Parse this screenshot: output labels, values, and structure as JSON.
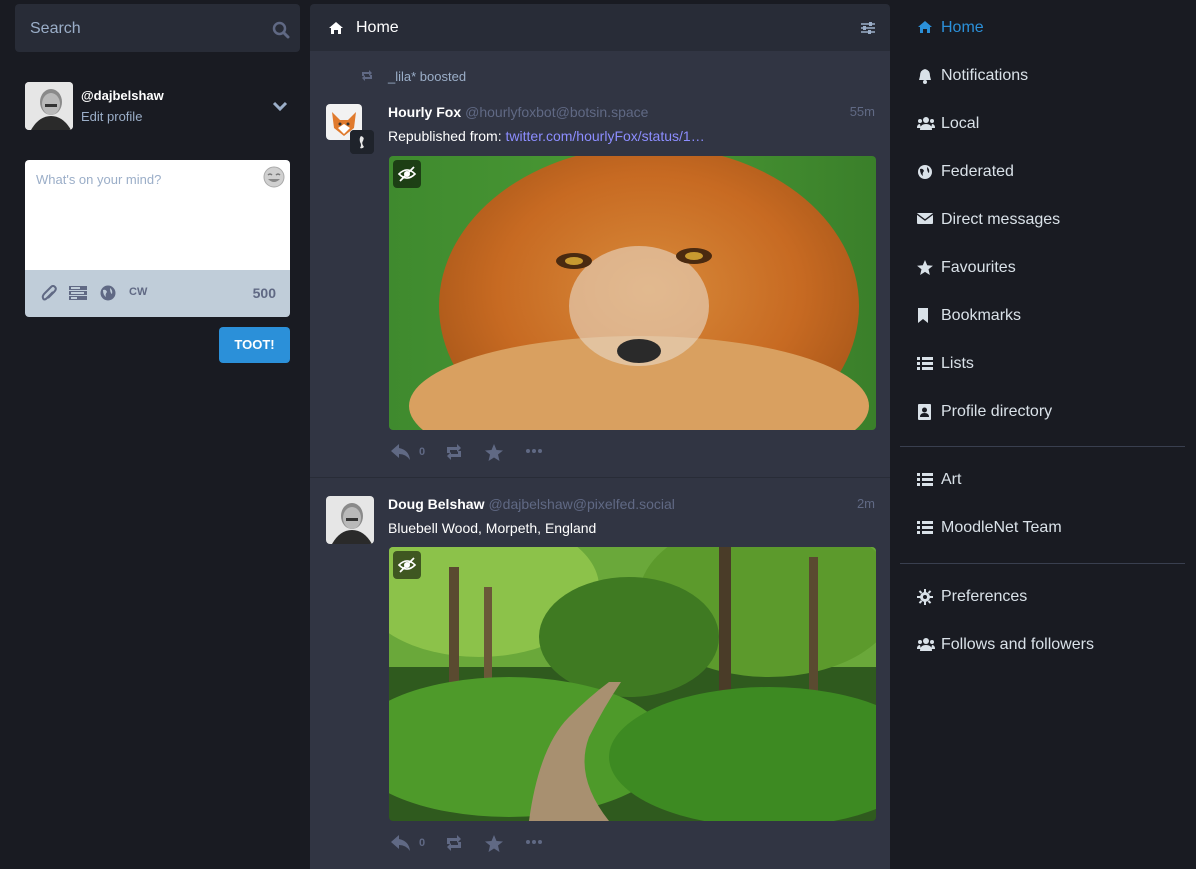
{
  "search": {
    "placeholder": "Search"
  },
  "profile": {
    "acct": "@dajbelshaw",
    "edit_label": "Edit profile"
  },
  "compose": {
    "placeholder": "What's on your mind?",
    "cw_label": "CW",
    "counter": "500",
    "toot_label": "TOOT!"
  },
  "column": {
    "title": "Home"
  },
  "statuses": [
    {
      "boosted_by": "_lila* boosted",
      "display_name": "Hourly Fox",
      "handle": "@hourlyfoxbot@botsin.space",
      "time": "55m",
      "content_prefix": "Republished from: ",
      "link": "twitter.com/hourlyFox/status/1…",
      "replies": "0",
      "image_description": "Close-up of a red fox curled up, green background"
    },
    {
      "display_name": "Doug Belshaw",
      "handle": "@dajbelshaw@pixelfed.social",
      "time": "2m",
      "content": "Bluebell Wood, Morpeth, England",
      "replies": "0",
      "image_description": "Woodland path through green trees"
    }
  ],
  "nav": {
    "items": [
      {
        "label": "Home",
        "icon": "home-icon"
      },
      {
        "label": "Notifications",
        "icon": "bell-icon"
      },
      {
        "label": "Local",
        "icon": "users-icon"
      },
      {
        "label": "Federated",
        "icon": "globe-icon"
      },
      {
        "label": "Direct messages",
        "icon": "envelope-icon"
      },
      {
        "label": "Favourites",
        "icon": "star-icon"
      },
      {
        "label": "Bookmarks",
        "icon": "bookmark-icon"
      },
      {
        "label": "Lists",
        "icon": "list-icon"
      },
      {
        "label": "Profile directory",
        "icon": "address-book-icon"
      }
    ],
    "lists": [
      {
        "label": "Art",
        "icon": "list-icon"
      },
      {
        "label": "MoodleNet Team",
        "icon": "list-icon"
      }
    ],
    "settings": [
      {
        "label": "Preferences",
        "icon": "gear-icon"
      },
      {
        "label": "Follows and followers",
        "icon": "users-icon"
      }
    ]
  },
  "colors": {
    "accent": "#2b90d9",
    "background": "#191b22",
    "column": "#313543",
    "header": "#282c37"
  }
}
